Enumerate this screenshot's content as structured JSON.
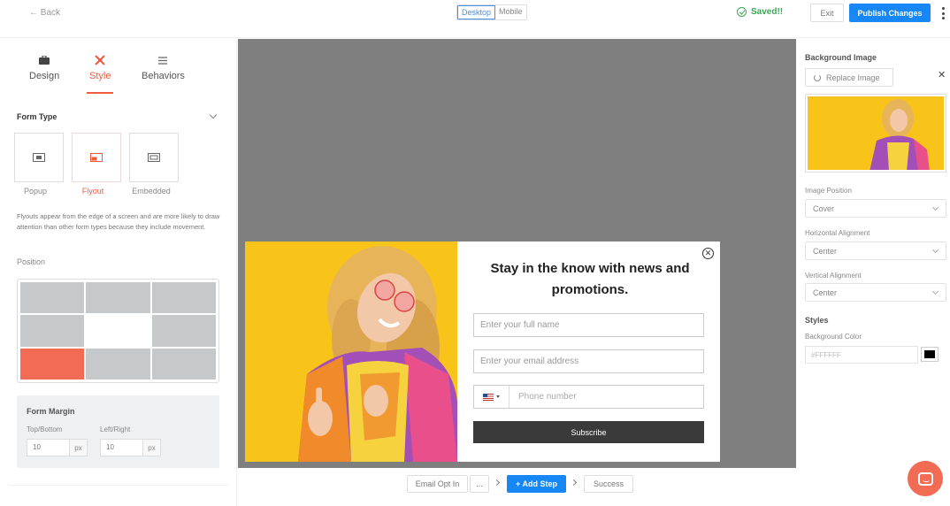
{
  "topbar": {
    "back_label": "← Back",
    "device_desktop": "Desktop",
    "device_mobile": "Mobile",
    "saved_label": "Saved!!",
    "exit_label": "Exit",
    "publish_label": "Publish Changes"
  },
  "left_panel": {
    "tabs": [
      {
        "label": "Design",
        "icon": "briefcase-icon"
      },
      {
        "label": "Style",
        "icon": "brush-icon",
        "active": true
      },
      {
        "label": "Behaviors",
        "icon": "list-icon"
      }
    ],
    "form_type_title": "Form Type",
    "form_types": [
      {
        "label": "Popup"
      },
      {
        "label": "Flyout",
        "active": true
      },
      {
        "label": "Embedded"
      }
    ],
    "description": "Flyouts appear from the edge of a screen and are more likely to draw attention than other form types because they include movement.",
    "position_label": "Position",
    "position_selected": "bottom-left",
    "form_margin": {
      "title": "Form Margin",
      "top_bottom_label": "Top/Bottom",
      "top_bottom_value": "10",
      "left_right_label": "Left/Right",
      "left_right_value": "10",
      "unit": "px"
    }
  },
  "popup": {
    "title": "Stay in the know with news and promotions.",
    "name_placeholder": "Enter your full name",
    "email_placeholder": "Enter your email address",
    "phone_placeholder": "Phone number",
    "subscribe_label": "Subscribe"
  },
  "steps": {
    "email_opt_in": "Email Opt In",
    "more": "...",
    "add_step": "+ Add Step",
    "success": "Success"
  },
  "right_panel": {
    "background_image_title": "Background Image",
    "replace_image_label": "Replace Image",
    "image_position_label": "Image Position",
    "image_position_value": "Cover",
    "horizontal_alignment_label": "Horizontal Alignment",
    "horizontal_alignment_value": "Center",
    "vertical_alignment_label": "Vertical Alignment",
    "vertical_alignment_value": "Center",
    "styles_title": "Styles",
    "background_color_label": "Background Color",
    "background_color_value": "#FFFFFF"
  },
  "colors": {
    "accent": "#f05a40",
    "primary_button": "#1687f5",
    "saved_green": "#3aa655",
    "canvas_bg": "#7f7f7f",
    "image_bg": "#f8c41a"
  }
}
